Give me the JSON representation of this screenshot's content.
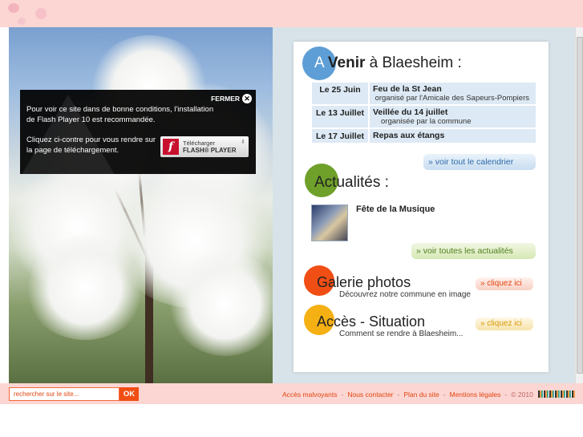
{
  "flash_notice": {
    "close_label": "FERMER",
    "message_1": "Pour voir ce site dans de bonne conditions, l'installation de Flash Player 10  est recommandée.",
    "message_2": "Cliquez ci-contre pour vous rendre sur la page de téléchargement.",
    "download_line_1": "Télécharger",
    "download_line_2": "FLASH® PLAYER"
  },
  "avenir": {
    "title_first_letter": "A",
    "title_bold": "Venir",
    "title_rest": " à Blaesheim :",
    "events": [
      {
        "date": "Le 25 Juin",
        "title": "Feu de la St Jean",
        "subtitle": "organisé par l'Amicale des Sapeurs-Pompiers"
      },
      {
        "date": "Le 13 Juillet",
        "title": "Veillée du 14 juillet",
        "subtitle": "organisée par la commune"
      },
      {
        "date": "Le 17 Juillet",
        "title": "Repas aux étangs",
        "subtitle": ""
      }
    ],
    "calendar_link": "» voir tout le calendrier"
  },
  "actualites": {
    "title": "Actualités :",
    "news_title": "Fête de la Musique",
    "news_link": "» voir toutes les actualités"
  },
  "galerie": {
    "title": "Galerie photos",
    "description": "Découvrez notre commune en image",
    "link": "» cliquez ici"
  },
  "acces": {
    "title": "Accès - Situation",
    "description": "Comment se rendre à Blaesheim...",
    "link": "» cliquez ici"
  },
  "footer": {
    "search_placeholder": "rechercher sur le site...",
    "search_button": "OK",
    "links": [
      "Accès malvoyants",
      "Nous contacter",
      "Plan du site",
      "Mentions légales"
    ],
    "copyright": "© 2010"
  },
  "colors": {
    "accent_blue": "#5e9ed6",
    "accent_green": "#6fa02a",
    "accent_orange": "#f04e14",
    "accent_yellow": "#f5b014",
    "footer_pink": "#fbd6d2"
  }
}
